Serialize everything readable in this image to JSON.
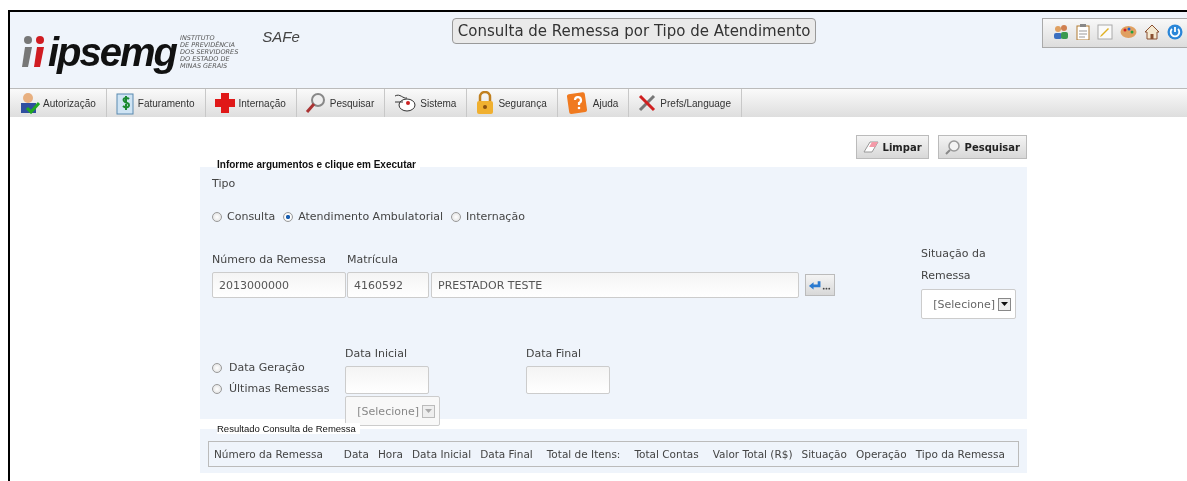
{
  "header": {
    "logo": "ipsemg",
    "logo_subtitle": [
      "INSTITUTO",
      "DE PREVIDÊNCIA",
      "DOS SERVIDORES",
      "DO ESTADO DE",
      "MINAS GERAIS"
    ],
    "app_name": "SAFe",
    "page_title": "Consulta de Remessa por Tipo de Atendimento"
  },
  "toolbar": [
    {
      "kind": "users"
    },
    {
      "kind": "clipboard"
    },
    {
      "kind": "edit"
    },
    {
      "kind": "palette"
    },
    {
      "kind": "home"
    },
    {
      "kind": "power"
    }
  ],
  "menu": [
    {
      "label": "Autorização",
      "kind": "user"
    },
    {
      "label": "Faturamento",
      "kind": "money"
    },
    {
      "label": "Internação",
      "kind": "cross"
    },
    {
      "label": "Pesquisar",
      "kind": "search"
    },
    {
      "label": "Sistema",
      "kind": "mouse"
    },
    {
      "label": "Segurança",
      "kind": "lock"
    },
    {
      "label": "Ajuda",
      "kind": "help"
    },
    {
      "label": "Prefs/Language",
      "kind": "tools"
    }
  ],
  "actions": [
    {
      "label": "Limpar",
      "kind": "eraser"
    },
    {
      "label": "Pesquisar",
      "kind": "search"
    }
  ],
  "form": {
    "legend": "Informe argumentos e clique em Executar",
    "tipo_label": "Tipo",
    "tipo_options": [
      {
        "label": "Consulta",
        "selected": false
      },
      {
        "label": "Atendimento Ambulatorial",
        "selected": true
      },
      {
        "label": "Internação",
        "selected": false
      }
    ],
    "numero_label": "Número da Remessa",
    "numero_value": "2013000000",
    "matricula_label": "Matrícula",
    "matricula_value": "4160592",
    "prestador_value": "PRESTADOR TESTE",
    "situacao_label": "Situação da Remessa",
    "situacao_value": "[Selecione]",
    "date_options": [
      {
        "label": "Data Geração",
        "selected": false
      },
      {
        "label": "Últimas Remessas",
        "selected": false
      }
    ],
    "data_inicial_label": "Data Inicial",
    "data_final_label": "Data Final",
    "ultimas_value": "[Selecione]"
  },
  "results": {
    "legend": "Resultado Consulta de Remessa",
    "columns": [
      "Número da Remessa",
      "Data",
      "Hora",
      "Data Inicial",
      "Data Final",
      "Total de Itens:",
      "Total Contas",
      "Valor Total (R$)",
      "Situação",
      "Operação",
      "Tipo da Remessa"
    ]
  }
}
